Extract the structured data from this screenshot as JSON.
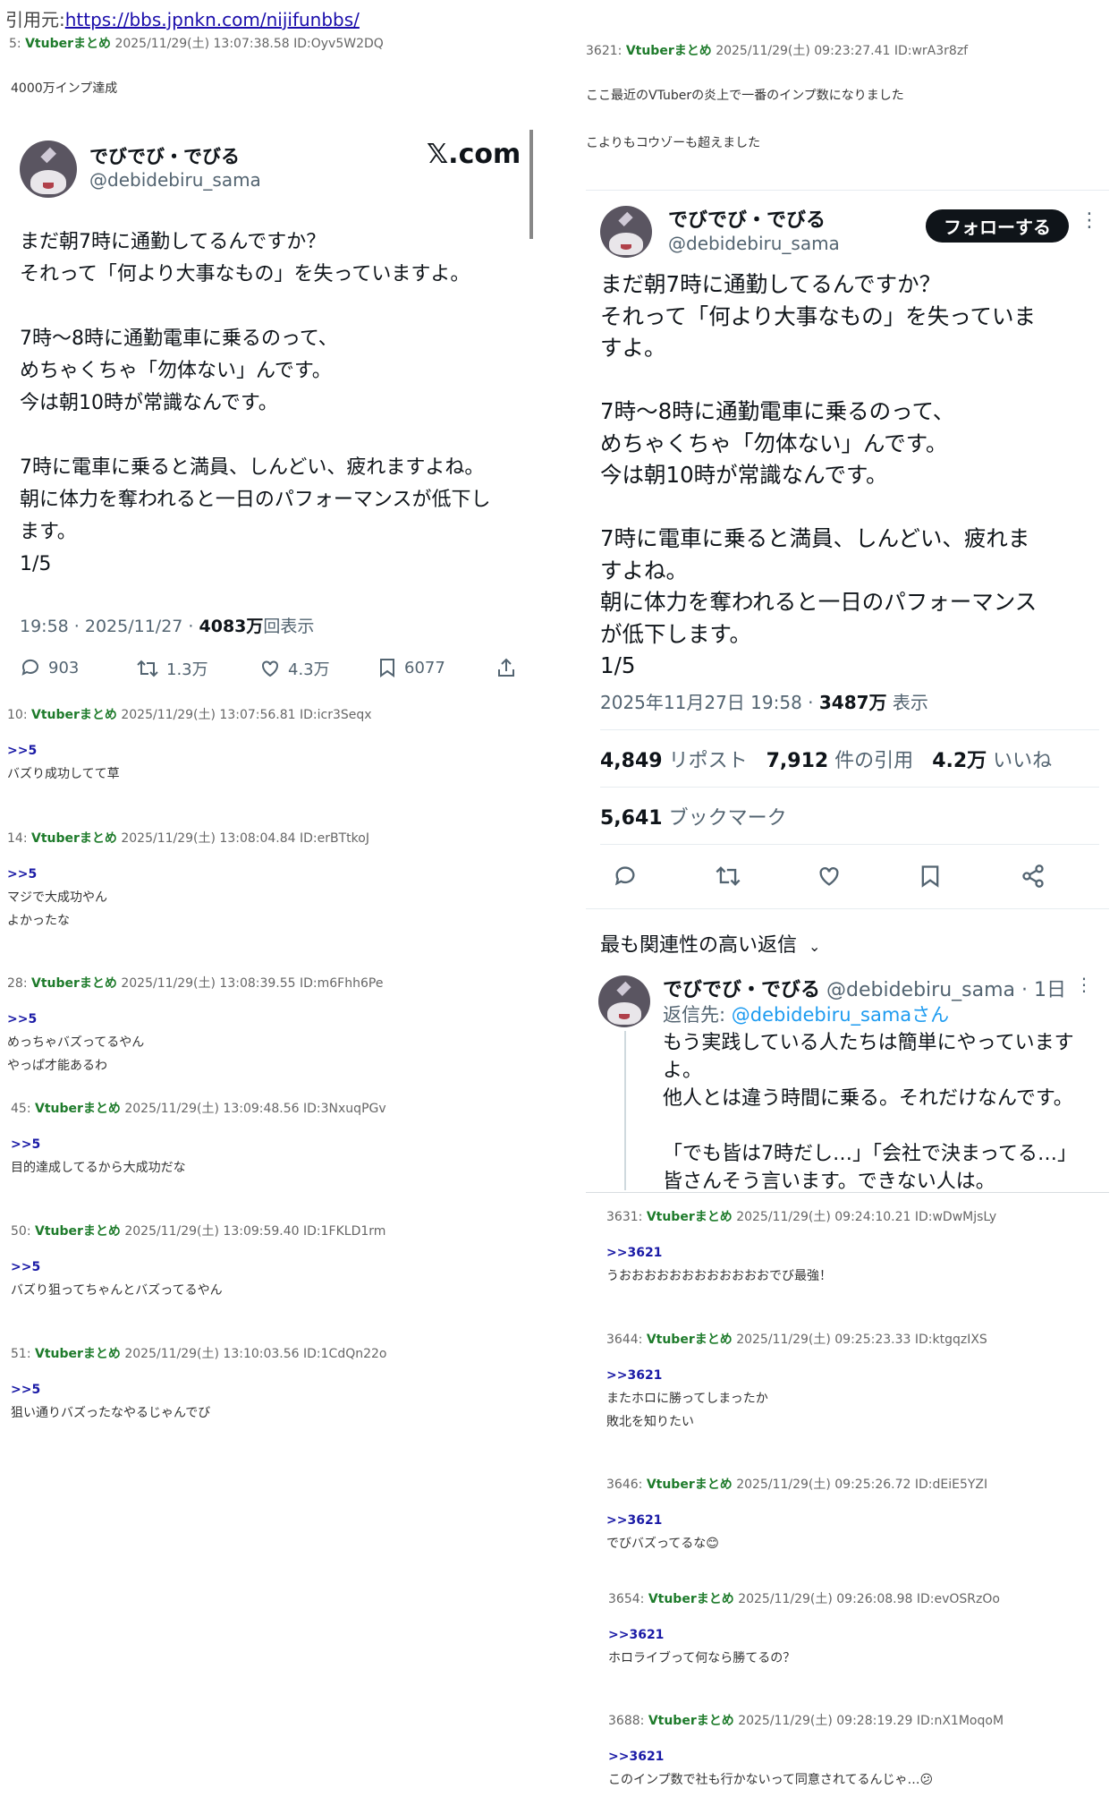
{
  "source": {
    "prefix": "引用元:",
    "url": "https://bbs.jpnkn.com/nijifunbbs/"
  },
  "left_posts_top": {
    "header": {
      "num": "5:",
      "name": "Vtuberまとめ",
      "info": "2025/11/29(土) 13:07:38.58 ID:Oyv5W2DQ"
    },
    "body": "4000万インプ達成"
  },
  "tweet_left": {
    "display_name": "でびでび・でびる",
    "handle": "@debidebiru_sama",
    "brand": "𝕏.com",
    "text": "まだ朝7時に通勤してるんですか？\nそれって「何より大事なもの」を失っていますよ。\n\n7時〜8時に通勤電車に乗るのって、\nめちゃくちゃ「勿体ない」んです。\n今は朝10時が常識なんです。\n\n7時に電車に乗ると満員、しんどい、疲れますよね。\n朝に体力を奪われると一日のパフォーマンスが低下し\nます。\n1/5",
    "time": "19:58 · 2025/11/27 · ",
    "views": "4083万",
    "views_label": "回表示",
    "replies": "903",
    "retweets": "1.3万",
    "likes": "4.3万",
    "bookmarks": "6077"
  },
  "left_posts": [
    {
      "num": "10:",
      "name": "Vtuberまとめ",
      "info": "2025/11/29(土) 13:07:56.81 ID:icr3Seqx",
      "anchor": ">>5",
      "lines": [
        "バズり成功してて草"
      ]
    },
    {
      "num": "14:",
      "name": "Vtuberまとめ",
      "info": "2025/11/29(土) 13:08:04.84 ID:erBTtkoJ",
      "anchor": ">>5",
      "lines": [
        "マジで大成功やん",
        "よかったな"
      ]
    },
    {
      "num": "28:",
      "name": "Vtuberまとめ",
      "info": "2025/11/29(土) 13:08:39.55 ID:m6Fhh6Pe",
      "anchor": ">>5",
      "lines": [
        "めっちゃバズってるやん",
        "やっぱ才能あるわ"
      ]
    },
    {
      "num": "45:",
      "name": "Vtuberまとめ",
      "info": "2025/11/29(土) 13:09:48.56 ID:3NxuqPGv",
      "anchor": ">>5",
      "lines": [
        "目的達成してるから大成功だな"
      ]
    },
    {
      "num": "50:",
      "name": "Vtuberまとめ",
      "info": "2025/11/29(土) 13:09:59.40 ID:1FKLD1rm",
      "anchor": ">>5",
      "lines": [
        "バズり狙ってちゃんとバズってるやん"
      ]
    },
    {
      "num": "51:",
      "name": "Vtuberまとめ",
      "info": "2025/11/29(土) 13:10:03.56 ID:1CdQn22o",
      "anchor": ">>5",
      "lines": [
        "狙い通りバズったなやるじゃんでび"
      ]
    }
  ],
  "right_post_top": {
    "header": {
      "num": "3621:",
      "name": "Vtuberまとめ",
      "info": "2025/11/29(土) 09:23:27.41 ID:wrA3r8zf"
    },
    "lines": [
      "ここ最近のVTuberの炎上で一番のインプ数になりました",
      "",
      "こよりもコウゾーも超えました"
    ]
  },
  "tweet_right": {
    "display_name": "でびでび・でびる",
    "handle": "@debidebiru_sama",
    "follow": "フォローする",
    "more": "⋮",
    "text": "まだ朝7時に通勤してるんですか？\nそれって「何より大事なもの」を失っていま\nすよ。\n\n7時〜8時に通勤電車に乗るのって、\nめちゃくちゃ「勿体ない」んです。\n今は朝10時が常識なんです。\n\n7時に電車に乗ると満員、しんどい、疲れま\nすよね。\n朝に体力を奪われると一日のパフォーマンス\nが低下します。\n1/5",
    "time": "2025年11月27日 19:58 · ",
    "views": "3487万",
    "views_label": " 表示",
    "reposts": "4,849",
    "reposts_label": " リポスト",
    "quotes": "7,912",
    "quotes_label": " 件の引用",
    "likes": "4.2万",
    "likes_label": " いいね",
    "bookmarks": "5,641",
    "bookmarks_label": " ブックマーク",
    "relevant": "最も関連性の高い返信",
    "reply": {
      "display_name": "でびでび・でびる",
      "handle": "@debidebiru_sama · 1日",
      "reply_to_prefix": "返信先: ",
      "reply_to": "@debidebiru_samaさん",
      "text": "もう実践している人たちは簡単にやっています\nよ。\n他人とは違う時間に乗る。それだけなんです。\n\n「でも皆は7時だし…」「会社で決まってる…」\n皆さんそう言います。できない人は。"
    }
  },
  "right_posts": [
    {
      "num": "3631:",
      "name": "Vtuberまとめ",
      "info": "2025/11/29(土) 09:24:10.21 ID:wDwMjsLy",
      "anchor": ">>3621",
      "lines": [
        "うおおおおおおおおおおおおでび最強！"
      ]
    },
    {
      "num": "3644:",
      "name": "Vtuberまとめ",
      "info": "2025/11/29(土) 09:25:23.33 ID:ktgqzIXS",
      "anchor": ">>3621",
      "lines": [
        "またホロに勝ってしまったか",
        "敗北を知りたい"
      ]
    },
    {
      "num": "3646:",
      "name": "Vtuberまとめ",
      "info": "2025/11/29(土) 09:25:26.72 ID:dEiE5YZI",
      "anchor": ">>3621",
      "lines": [
        "でびバズってるな😊"
      ]
    },
    {
      "num": "3654:",
      "name": "Vtuberまとめ",
      "info": "2025/11/29(土) 09:26:08.98 ID:evOSRzOo",
      "anchor": ">>3621",
      "lines": [
        "ホロライブって何なら勝てるの？"
      ]
    },
    {
      "num": "3688:",
      "name": "Vtuberまとめ",
      "info": "2025/11/29(土) 09:28:19.29 ID:nX1MoqoM",
      "anchor": ">>3621",
      "lines": [
        "このインプ数で社も行かないって同意されてるんじゃ…😕"
      ]
    }
  ]
}
